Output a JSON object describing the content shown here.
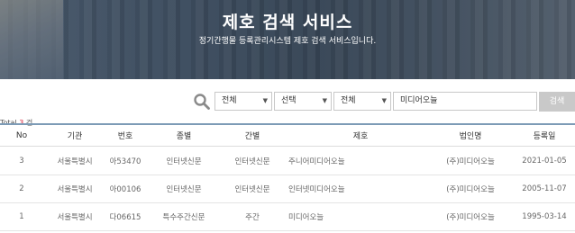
{
  "hero": {
    "title": "제호 검색 서비스",
    "subtitle": "정기간행물 등록관리시스템 제호 검색 서비스입니다."
  },
  "search": {
    "select_1": "전체",
    "select_2": "선택",
    "select_3": "전체",
    "keyword_value": "미디어오늘",
    "button_label": "검색",
    "icon": "search-icon"
  },
  "summary": {
    "total_label": "Total",
    "total_count": "3",
    "total_unit": "건"
  },
  "table": {
    "headers": {
      "no": "No",
      "org": "기관",
      "num": "번호",
      "type": "종별",
      "issue": "간별",
      "title": "제호",
      "corp": "법인명",
      "date": "등록일"
    },
    "rows": [
      {
        "no": "3",
        "org": "서울특별시",
        "num": "아53470",
        "type": "인터넷신문",
        "issue": "인터넷신문",
        "title": "주니어미디어오늘",
        "corp": "(주)미디어오늘",
        "date": "2021-01-05"
      },
      {
        "no": "2",
        "org": "서울특별시",
        "num": "아00106",
        "type": "인터넷신문",
        "issue": "인터넷신문",
        "title": "인터넷미디어오늘",
        "corp": "(주)미디어오늘",
        "date": "2005-11-07"
      },
      {
        "no": "1",
        "org": "서울특별시",
        "num": "다06615",
        "type": "특수주간신문",
        "issue": "주간",
        "title": "미디어오늘",
        "corp": "(주)미디어오늘",
        "date": "1995-03-14"
      }
    ]
  }
}
